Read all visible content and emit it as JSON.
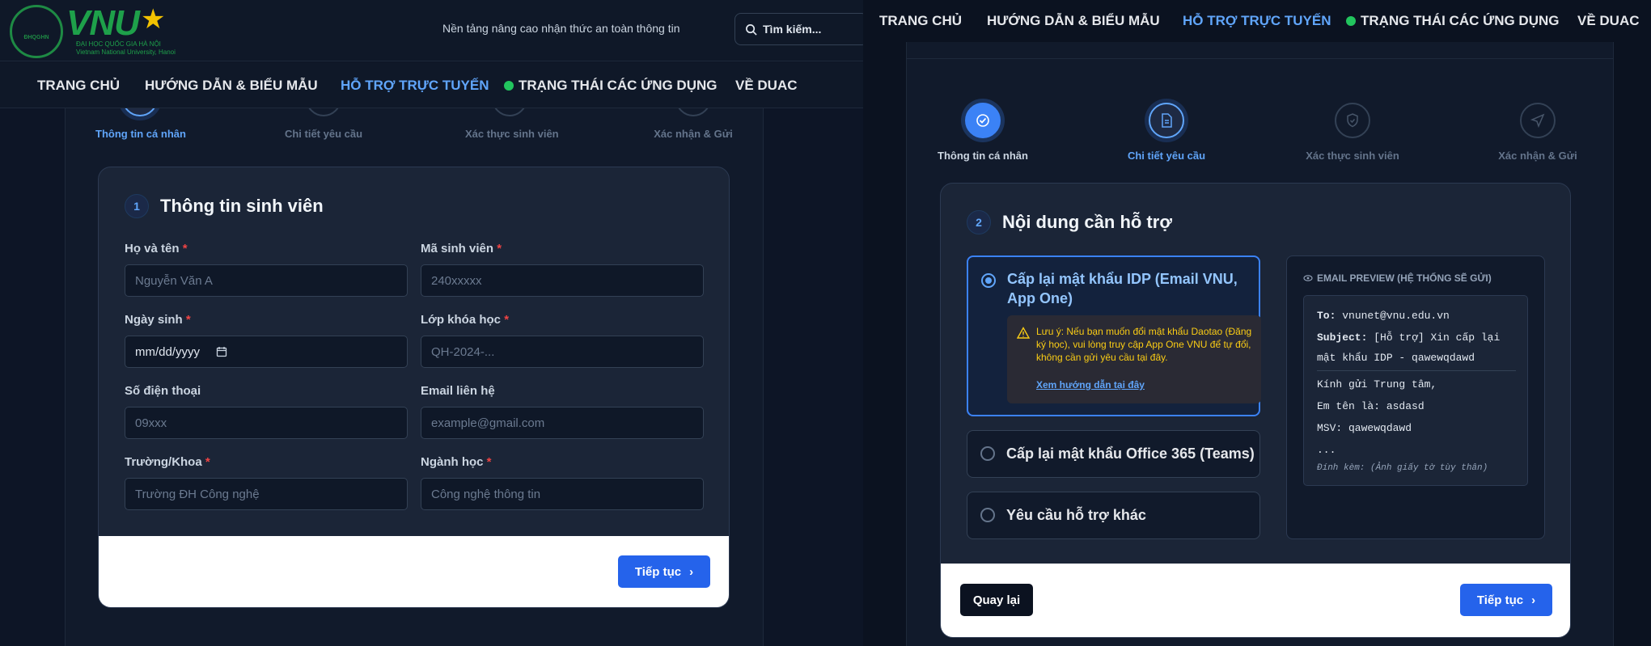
{
  "header": {
    "logo": {
      "name": "VNU",
      "badge_text": "ĐHQGHN",
      "subtitle_vi": "ĐẠI HỌC QUỐC GIA HÀ NỘI",
      "subtitle_en": "Vietnam National University, Hanoi"
    },
    "tagline": "Nền tảng nâng cao nhận thức an toàn thông tin",
    "search": {
      "placeholder": "Tìm kiếm...",
      "icon": "search-icon"
    }
  },
  "nav": {
    "items": [
      {
        "label": "TRANG CHỦ"
      },
      {
        "label": "HƯỚNG DẪN & BIỂU MẪU"
      },
      {
        "label": "HỖ TRỢ TRỰC TUYẾN",
        "active": true
      },
      {
        "label": "TRẠNG THÁI CÁC ỨNG DỤNG",
        "status_color": "#22c55e"
      },
      {
        "label": "VỀ DUAC"
      }
    ]
  },
  "steps": [
    {
      "label": "Thông tin cá nhân",
      "icon": "user-icon"
    },
    {
      "label": "Chi tiết yêu cầu",
      "icon": "document-icon"
    },
    {
      "label": "Xác thực sinh viên",
      "icon": "shield-check-icon"
    },
    {
      "label": "Xác nhận & Gửi",
      "icon": "send-icon"
    }
  ],
  "left_form": {
    "step_number": "1",
    "title": "Thông tin sinh viên",
    "fields": {
      "fullname": {
        "label": "Họ và tên",
        "required": "*",
        "placeholder": "Nguyễn Văn A"
      },
      "student_id": {
        "label": "Mã sinh viên",
        "required": "*",
        "placeholder": "240xxxxx"
      },
      "birthday": {
        "label": "Ngày sinh",
        "required": "*",
        "placeholder": "mm/dd/yyyy"
      },
      "class": {
        "label": "Lớp khóa học",
        "required": "*",
        "placeholder": "QH-2024-..."
      },
      "phone": {
        "label": "Số điện thoại",
        "placeholder": "09xxx"
      },
      "email": {
        "label": "Email liên hệ",
        "placeholder": "example@gmail.com"
      },
      "faculty": {
        "label": "Trường/Khoa",
        "required": "*",
        "placeholder": "Trường ĐH Công nghệ"
      },
      "major": {
        "label": "Ngành học",
        "required": "*",
        "placeholder": "Công nghệ thông tin"
      }
    },
    "next_button": "Tiếp tục"
  },
  "right_form": {
    "step_number": "2",
    "title": "Nội dung cần hỗ trợ",
    "options": [
      {
        "label": "Cấp lại mật khẩu IDP (Email VNU, App One)",
        "selected": true
      },
      {
        "label": "Cấp lại mật khẩu Office 365 (Teams)",
        "selected": false
      },
      {
        "label": "Yêu cầu hỗ trợ khác",
        "selected": false
      }
    ],
    "notice": {
      "text": "Lưu ý: Nếu bạn muốn đổi mật khẩu Daotao (Đăng ký học), vui lòng truy cập App One VNU để tự đổi, không cần gửi yêu cầu tại đây.",
      "link": "Xem hướng dẫn tại đây"
    },
    "preview": {
      "title": "EMAIL PREVIEW (HỆ THỐNG SẼ GỬI)",
      "to_label": "To:",
      "to_value": "vnunet@vnu.edu.vn",
      "subject_label": "Subject:",
      "subject_line1": "[Hỗ trợ] Xin cấp lại",
      "subject_line2": "mật khẩu IDP - qawewqdawd",
      "greeting": "Kính gửi Trung tâm,",
      "name_line": "Em tên là: asdasd",
      "msv_line": "MSV: qawewqdawd",
      "ellipsis": "...",
      "attachment": "Đính kèm: (Ảnh giấy tờ tùy thân)"
    },
    "back_button": "Quay lại",
    "next_button": "Tiếp tục"
  }
}
